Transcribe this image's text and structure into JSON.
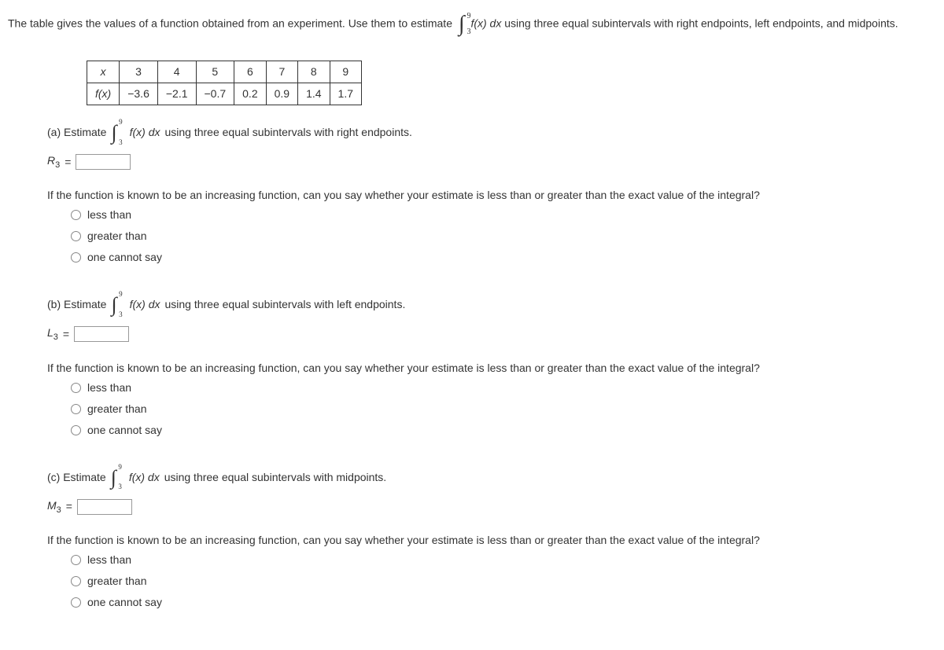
{
  "intro": {
    "text_before": "The table gives the values of a function obtained from an experiment. Use them to estimate",
    "upper": "9",
    "lower": "3",
    "fxdx": "f(x) dx",
    "text_after": "using three equal subintervals with right endpoints, left endpoints, and midpoints."
  },
  "table": {
    "row_x_label": "x",
    "row_fx_label": "f(x)",
    "x_values": [
      "3",
      "4",
      "5",
      "6",
      "7",
      "8",
      "9"
    ],
    "fx_values": [
      "−3.6",
      "−2.1",
      "−0.7",
      "0.2",
      "0.9",
      "1.4",
      "1.7"
    ]
  },
  "parts": {
    "a": {
      "label": "(a) Estimate",
      "upper": "9",
      "lower": "3",
      "fxdx": "f(x) dx",
      "desc": "using three equal subintervals with right endpoints.",
      "var": "R",
      "sub": "3",
      "eq": "="
    },
    "b": {
      "label": "(b) Estimate",
      "upper": "9",
      "lower": "3",
      "fxdx": "f(x) dx",
      "desc": "using three equal subintervals with left endpoints.",
      "var": "L",
      "sub": "3",
      "eq": "="
    },
    "c": {
      "label": "(c) Estimate",
      "upper": "9",
      "lower": "3",
      "fxdx": "f(x) dx",
      "desc": "using three equal subintervals with midpoints.",
      "var": "M",
      "sub": "3",
      "eq": "="
    }
  },
  "followup_text": "If the function is known to be an increasing function, can you say whether your estimate is less than or greater than the exact value of the integral?",
  "options": {
    "opt1": "less than",
    "opt2": "greater than",
    "opt3": "one cannot say"
  }
}
